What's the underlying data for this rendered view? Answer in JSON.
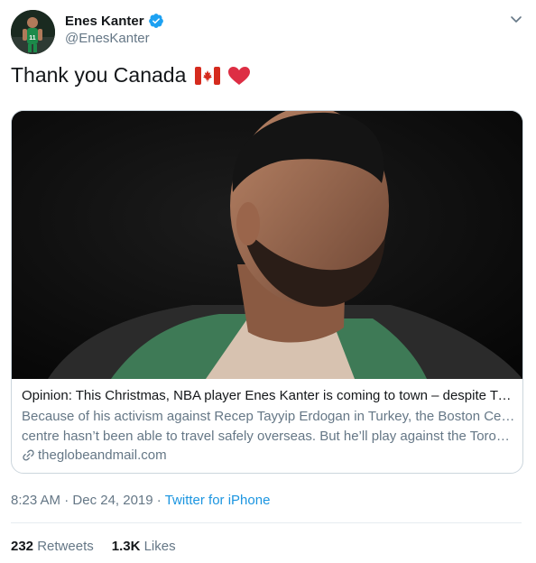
{
  "author": {
    "name": "Enes Kanter",
    "handle": "@EnesKanter",
    "verified": true,
    "jersey_number": "11"
  },
  "tweet": {
    "text": "Thank you Canada",
    "emoji": [
      "canada-flag",
      "red-heart"
    ]
  },
  "card": {
    "title": "Opinion: This Christmas, NBA player Enes Kanter is coming to town – despite Tur...",
    "description_line1": "Because of his activism against Recep Tayyip Erdogan in Turkey, the Boston Celtics",
    "description_line2": "centre hasn’t been able to travel safely overseas. But he’ll play against the Toront...",
    "domain": "theglobeandmail.com"
  },
  "meta": {
    "time": "8:23 AM",
    "separator": " · ",
    "date": "Dec 24, 2019",
    "separator2": " · ",
    "source": "Twitter for iPhone"
  },
  "stats": {
    "retweets_count": "232",
    "retweets_label": "Retweets",
    "likes_count": "1.3K",
    "likes_label": "Likes"
  },
  "colors": {
    "accent": "#1b95e0",
    "secondary_text": "#657786",
    "verified": "#1da1f2",
    "heart": "#dd2e44",
    "jersey_green": "#1c8a4a"
  }
}
